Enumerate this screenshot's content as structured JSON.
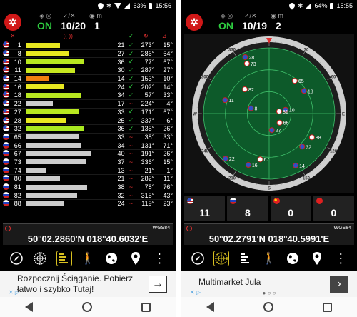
{
  "left": {
    "status": {
      "battery": "63%",
      "time": "15:56"
    },
    "header": {
      "status": "ON",
      "sats": "10/20",
      "count": "1"
    },
    "rows": [
      {
        "flag": "us",
        "prn": "1",
        "fill": 0.39,
        "color": "#e8e820",
        "snr": "21",
        "used": "✓",
        "az": "273°",
        "el": "15°"
      },
      {
        "flag": "us",
        "prn": "8",
        "fill": 0.5,
        "color": "#e8e820",
        "snr": "27",
        "used": "✓",
        "az": "286°",
        "el": "64°"
      },
      {
        "flag": "us",
        "prn": "10",
        "fill": 0.67,
        "color": "#b8e820",
        "snr": "36",
        "used": "✓",
        "az": "77°",
        "el": "67°"
      },
      {
        "flag": "us",
        "prn": "11",
        "fill": 0.56,
        "color": "#c8e820",
        "snr": "30",
        "used": "✓",
        "az": "287°",
        "el": "27°"
      },
      {
        "flag": "us",
        "prn": "14",
        "fill": 0.26,
        "color": "#f08010",
        "snr": "14",
        "used": "✓",
        "az": "153°",
        "el": "10°"
      },
      {
        "flag": "us",
        "prn": "16",
        "fill": 0.44,
        "color": "#e8e820",
        "snr": "24",
        "used": "✓",
        "az": "202°",
        "el": "14°"
      },
      {
        "flag": "us",
        "prn": "18",
        "fill": 0.63,
        "color": "#b8e820",
        "snr": "34",
        "used": "✓",
        "az": "57°",
        "el": "33°"
      },
      {
        "flag": "us",
        "prn": "22",
        "fill": 0.31,
        "color": "#cccccc",
        "snr": "17",
        "used": "~",
        "az": "224°",
        "el": "4°"
      },
      {
        "flag": "us",
        "prn": "27",
        "fill": 0.61,
        "color": "#b8e820",
        "snr": "33",
        "used": "✓",
        "az": "171°",
        "el": "67°"
      },
      {
        "flag": "us",
        "prn": "28",
        "fill": 0.46,
        "color": "#e8e820",
        "snr": "25",
        "used": "✓",
        "az": "337°",
        "el": "6°"
      },
      {
        "flag": "us",
        "prn": "32",
        "fill": 0.67,
        "color": "#a8e820",
        "snr": "36",
        "used": "✓",
        "az": "135°",
        "el": "26°"
      },
      {
        "flag": "ru",
        "prn": "65",
        "fill": 0.61,
        "color": "#cccccc",
        "snr": "33",
        "used": "~",
        "az": "38°",
        "el": "33°"
      },
      {
        "flag": "ru",
        "prn": "66",
        "fill": 0.63,
        "color": "#cccccc",
        "snr": "34",
        "used": "~",
        "az": "131°",
        "el": "71°"
      },
      {
        "flag": "ru",
        "prn": "67",
        "fill": 0.74,
        "color": "#cccccc",
        "snr": "40",
        "used": "~",
        "az": "191°",
        "el": "26°"
      },
      {
        "flag": "ru",
        "prn": "73",
        "fill": 0.69,
        "color": "#cccccc",
        "snr": "37",
        "used": "~",
        "az": "336°",
        "el": "15°"
      },
      {
        "flag": "ru",
        "prn": "74",
        "fill": 0.24,
        "color": "#cccccc",
        "snr": "13",
        "used": "~",
        "az": "21°",
        "el": "1°"
      },
      {
        "flag": "ru",
        "prn": "80",
        "fill": 0.39,
        "color": "#cccccc",
        "snr": "21",
        "used": "~",
        "az": "282°",
        "el": "11°"
      },
      {
        "flag": "ru",
        "prn": "81",
        "fill": 0.7,
        "color": "#cccccc",
        "snr": "38",
        "used": "~",
        "az": "78°",
        "el": "76°"
      },
      {
        "flag": "ru",
        "prn": "82",
        "fill": 0.59,
        "color": "#cccccc",
        "snr": "32",
        "used": "~",
        "az": "315°",
        "el": "43°"
      },
      {
        "flag": "ru",
        "prn": "88",
        "fill": 0.44,
        "color": "#cccccc",
        "snr": "24",
        "used": "~",
        "az": "119°",
        "el": "23°"
      }
    ],
    "coords": "50°02.2860'N  018°40.6032'E",
    "datum": "WGS84",
    "ad": {
      "text": "Rozpocznij Ściąganie. Pobierz łatwo i szybko Tutaj!",
      "arrow": "→"
    }
  },
  "right": {
    "status": {
      "battery": "64%",
      "time": "15:55"
    },
    "header": {
      "status": "ON",
      "sats": "10/19",
      "count": "2"
    },
    "counts": [
      {
        "flag": "us",
        "value": "11"
      },
      {
        "flag": "ru",
        "value": "8"
      },
      {
        "flag": "cn",
        "value": "0"
      },
      {
        "flag": "red",
        "value": "0"
      }
    ],
    "coords": "50°02.2791'N  018°40.5991'E",
    "datum": "WGS84",
    "ad": {
      "text": "Multimarket Jula",
      "arrow": "›"
    },
    "radar": {
      "dial_labels": [
        "N",
        "30",
        "60",
        "E",
        "120",
        "150",
        "S",
        "210",
        "240",
        "W",
        "300",
        "330"
      ],
      "sats": [
        {
          "id": "28",
          "az": 337,
          "el": 6,
          "flag": "us"
        },
        {
          "id": "73",
          "az": 336,
          "el": 15,
          "flag": "ru"
        },
        {
          "id": "65",
          "az": 38,
          "el": 33,
          "flag": "ru"
        },
        {
          "id": "18",
          "az": 57,
          "el": 33,
          "flag": "us"
        },
        {
          "id": "82",
          "az": 315,
          "el": 43,
          "flag": "ru"
        },
        {
          "id": "8",
          "az": 286,
          "el": 64,
          "flag": "us"
        },
        {
          "id": "11",
          "az": 287,
          "el": 27,
          "flag": "us"
        },
        {
          "id": "10",
          "az": 77,
          "el": 67,
          "flag": "us"
        },
        {
          "id": "81",
          "az": 78,
          "el": 76,
          "flag": "ru"
        },
        {
          "id": "66",
          "az": 131,
          "el": 71,
          "flag": "ru"
        },
        {
          "id": "27",
          "az": 171,
          "el": 67,
          "flag": "us"
        },
        {
          "id": "32",
          "az": 135,
          "el": 26,
          "flag": "us"
        },
        {
          "id": "88",
          "az": 119,
          "el": 23,
          "flag": "ru"
        },
        {
          "id": "67",
          "az": 191,
          "el": 26,
          "flag": "ru"
        },
        {
          "id": "16",
          "az": 202,
          "el": 14,
          "flag": "us"
        },
        {
          "id": "22",
          "az": 224,
          "el": 4,
          "flag": "us"
        },
        {
          "id": "14",
          "az": 153,
          "el": 10,
          "flag": "us"
        }
      ]
    }
  },
  "toolbar": [
    "compass",
    "radar",
    "signal-bars",
    "walk",
    "globe",
    "map-pin",
    "more"
  ]
}
